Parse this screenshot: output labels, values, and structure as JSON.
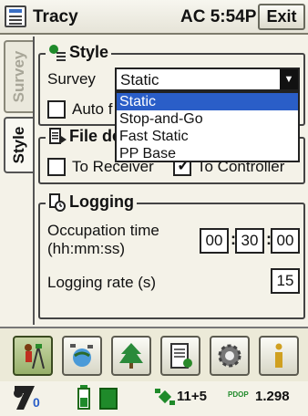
{
  "titlebar": {
    "title": "Tracy",
    "clock": "AC  5:54P",
    "exit_label": "Exit"
  },
  "tabs": [
    {
      "label": "Survey",
      "active": false
    },
    {
      "label": "Style",
      "active": true
    }
  ],
  "style_group": {
    "title": "Style",
    "survey_label": "Survey",
    "survey_value": "Static",
    "options": [
      "Static",
      "Stop-and-Go",
      "Fast Static",
      "PP Base"
    ],
    "auto_label": "Auto f"
  },
  "file_group": {
    "title": "File de",
    "to_receiver_label": "To Receiver",
    "to_receiver_checked": false,
    "to_controller_label": "To Controller",
    "to_controller_checked": true
  },
  "logging_group": {
    "title": "Logging",
    "occupation_label_1": "Occupation time",
    "occupation_label_2": "(hh:mm:ss)",
    "hh": "00",
    "mm": "30",
    "ss": "00",
    "rate_label": "Logging rate (s)",
    "rate_value": "15"
  },
  "statusbar": {
    "satellites": "11+5",
    "pdop_label": "PDOP",
    "pdop_value": "1.298",
    "receiver_subscript": "0"
  },
  "colors": {
    "selection": "#2a5ec8",
    "accent_green": "#1f8a2a"
  }
}
